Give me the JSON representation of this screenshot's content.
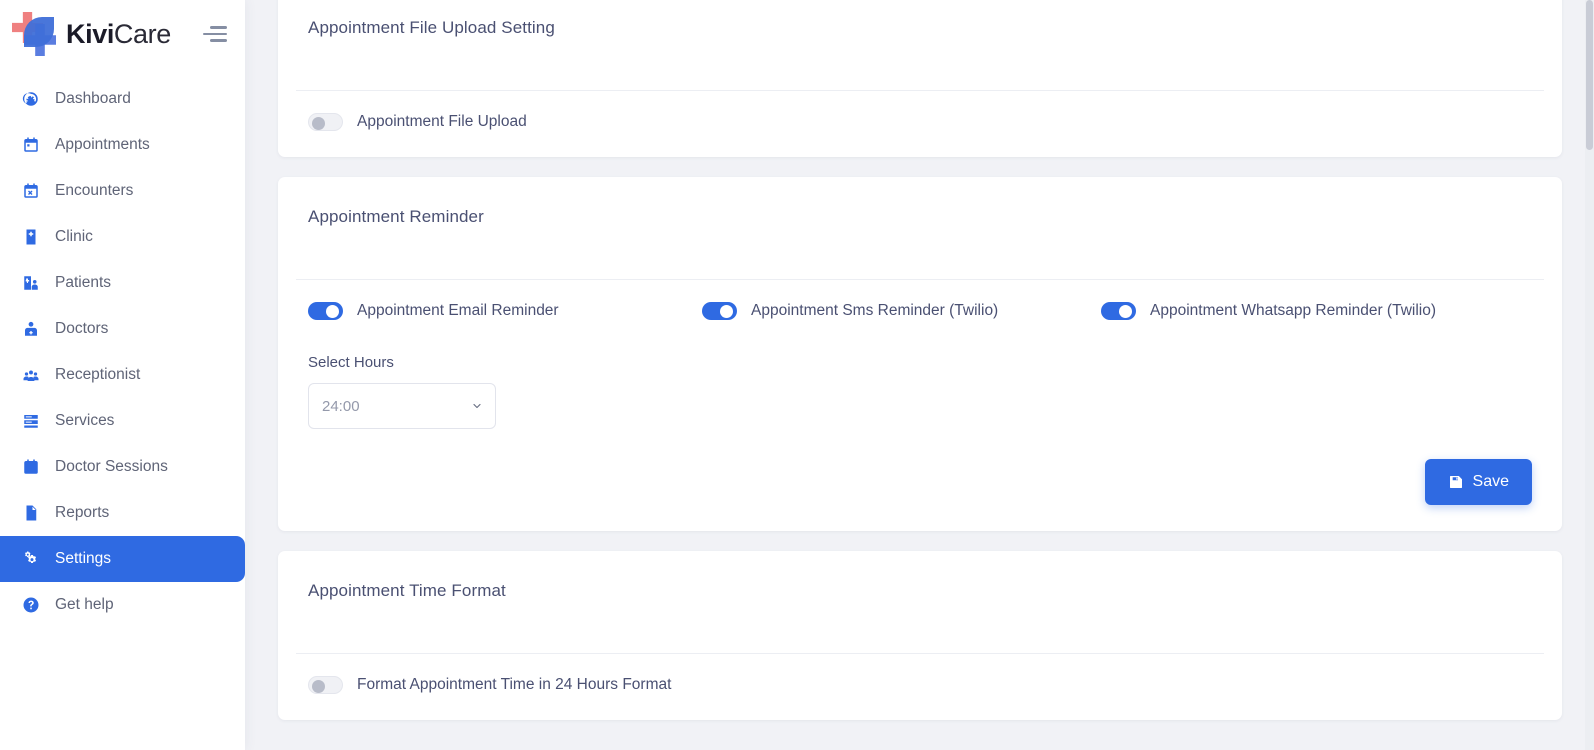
{
  "brand": {
    "name_bold": "Kivi",
    "name_light": "Care",
    "logo_icon": "kivicare-cross-logo",
    "menu_toggle_icon": "hamburger-icon"
  },
  "sidebar": {
    "items": [
      {
        "label": "Dashboard",
        "icon": "speedometer-icon",
        "active": false
      },
      {
        "label": "Appointments",
        "icon": "calendar-icon",
        "active": false
      },
      {
        "label": "Encounters",
        "icon": "calendar-check-icon",
        "active": false
      },
      {
        "label": "Clinic",
        "icon": "hospital-icon",
        "active": false
      },
      {
        "label": "Patients",
        "icon": "patients-icon",
        "active": false
      },
      {
        "label": "Doctors",
        "icon": "doctor-icon",
        "active": false
      },
      {
        "label": "Receptionist",
        "icon": "people-group-icon",
        "active": false
      },
      {
        "label": "Services",
        "icon": "server-list-icon",
        "active": false
      },
      {
        "label": "Doctor Sessions",
        "icon": "calendar-filled-icon",
        "active": false
      },
      {
        "label": "Reports",
        "icon": "document-icon",
        "active": false
      },
      {
        "label": "Settings",
        "icon": "gears-icon",
        "active": true
      },
      {
        "label": "Get help",
        "icon": "question-circle-icon",
        "active": false
      }
    ]
  },
  "cards": {
    "file_upload": {
      "title": "Appointment File Upload Setting",
      "toggle_label": "Appointment File Upload",
      "toggle_state": "off"
    },
    "reminder": {
      "title": "Appointment Reminder",
      "toggles": [
        {
          "label": "Appointment Email Reminder",
          "state": "on"
        },
        {
          "label": "Appointment Sms Reminder (Twilio)",
          "state": "on"
        },
        {
          "label": "Appointment Whatsapp Reminder (Twilio)",
          "state": "on"
        }
      ],
      "select_hours_label": "Select Hours",
      "select_hours_value": "24:00",
      "select_hours_options": [
        "24:00"
      ],
      "save_label": "Save",
      "save_icon": "floppy-disk-icon"
    },
    "time_format": {
      "title": "Appointment Time Format",
      "toggle_label": "Format Appointment Time in 24 Hours Format",
      "toggle_state": "off"
    }
  },
  "colors": {
    "accent": "#2f6ae2",
    "heading": "#4a5072",
    "page_bg": "#f1f2f6",
    "logo_red": "#ef8080",
    "logo_blue": "#5a7de0"
  }
}
